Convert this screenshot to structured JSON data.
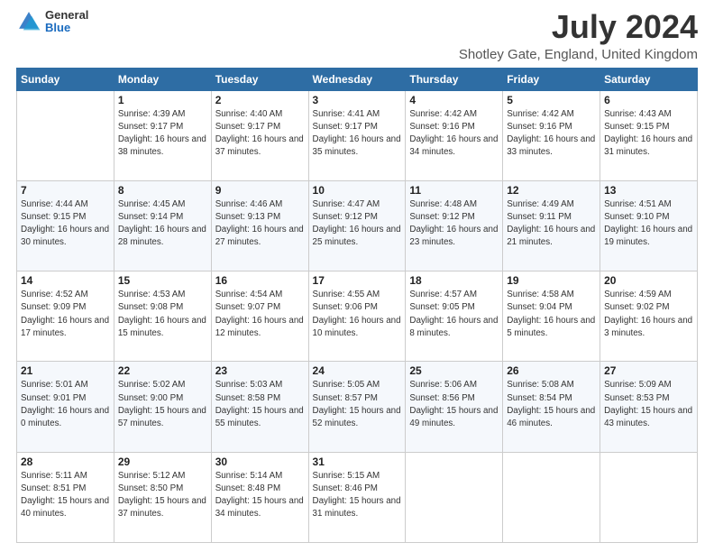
{
  "logo": {
    "line1": "General",
    "line2": "Blue"
  },
  "title": "July 2024",
  "subtitle": "Shotley Gate, England, United Kingdom",
  "days_of_week": [
    "Sunday",
    "Monday",
    "Tuesday",
    "Wednesday",
    "Thursday",
    "Friday",
    "Saturday"
  ],
  "weeks": [
    [
      {
        "day": "",
        "sunrise": "",
        "sunset": "",
        "daylight": ""
      },
      {
        "day": "1",
        "sunrise": "Sunrise: 4:39 AM",
        "sunset": "Sunset: 9:17 PM",
        "daylight": "Daylight: 16 hours and 38 minutes."
      },
      {
        "day": "2",
        "sunrise": "Sunrise: 4:40 AM",
        "sunset": "Sunset: 9:17 PM",
        "daylight": "Daylight: 16 hours and 37 minutes."
      },
      {
        "day": "3",
        "sunrise": "Sunrise: 4:41 AM",
        "sunset": "Sunset: 9:17 PM",
        "daylight": "Daylight: 16 hours and 35 minutes."
      },
      {
        "day": "4",
        "sunrise": "Sunrise: 4:42 AM",
        "sunset": "Sunset: 9:16 PM",
        "daylight": "Daylight: 16 hours and 34 minutes."
      },
      {
        "day": "5",
        "sunrise": "Sunrise: 4:42 AM",
        "sunset": "Sunset: 9:16 PM",
        "daylight": "Daylight: 16 hours and 33 minutes."
      },
      {
        "day": "6",
        "sunrise": "Sunrise: 4:43 AM",
        "sunset": "Sunset: 9:15 PM",
        "daylight": "Daylight: 16 hours and 31 minutes."
      }
    ],
    [
      {
        "day": "7",
        "sunrise": "Sunrise: 4:44 AM",
        "sunset": "Sunset: 9:15 PM",
        "daylight": "Daylight: 16 hours and 30 minutes."
      },
      {
        "day": "8",
        "sunrise": "Sunrise: 4:45 AM",
        "sunset": "Sunset: 9:14 PM",
        "daylight": "Daylight: 16 hours and 28 minutes."
      },
      {
        "day": "9",
        "sunrise": "Sunrise: 4:46 AM",
        "sunset": "Sunset: 9:13 PM",
        "daylight": "Daylight: 16 hours and 27 minutes."
      },
      {
        "day": "10",
        "sunrise": "Sunrise: 4:47 AM",
        "sunset": "Sunset: 9:12 PM",
        "daylight": "Daylight: 16 hours and 25 minutes."
      },
      {
        "day": "11",
        "sunrise": "Sunrise: 4:48 AM",
        "sunset": "Sunset: 9:12 PM",
        "daylight": "Daylight: 16 hours and 23 minutes."
      },
      {
        "day": "12",
        "sunrise": "Sunrise: 4:49 AM",
        "sunset": "Sunset: 9:11 PM",
        "daylight": "Daylight: 16 hours and 21 minutes."
      },
      {
        "day": "13",
        "sunrise": "Sunrise: 4:51 AM",
        "sunset": "Sunset: 9:10 PM",
        "daylight": "Daylight: 16 hours and 19 minutes."
      }
    ],
    [
      {
        "day": "14",
        "sunrise": "Sunrise: 4:52 AM",
        "sunset": "Sunset: 9:09 PM",
        "daylight": "Daylight: 16 hours and 17 minutes."
      },
      {
        "day": "15",
        "sunrise": "Sunrise: 4:53 AM",
        "sunset": "Sunset: 9:08 PM",
        "daylight": "Daylight: 16 hours and 15 minutes."
      },
      {
        "day": "16",
        "sunrise": "Sunrise: 4:54 AM",
        "sunset": "Sunset: 9:07 PM",
        "daylight": "Daylight: 16 hours and 12 minutes."
      },
      {
        "day": "17",
        "sunrise": "Sunrise: 4:55 AM",
        "sunset": "Sunset: 9:06 PM",
        "daylight": "Daylight: 16 hours and 10 minutes."
      },
      {
        "day": "18",
        "sunrise": "Sunrise: 4:57 AM",
        "sunset": "Sunset: 9:05 PM",
        "daylight": "Daylight: 16 hours and 8 minutes."
      },
      {
        "day": "19",
        "sunrise": "Sunrise: 4:58 AM",
        "sunset": "Sunset: 9:04 PM",
        "daylight": "Daylight: 16 hours and 5 minutes."
      },
      {
        "day": "20",
        "sunrise": "Sunrise: 4:59 AM",
        "sunset": "Sunset: 9:02 PM",
        "daylight": "Daylight: 16 hours and 3 minutes."
      }
    ],
    [
      {
        "day": "21",
        "sunrise": "Sunrise: 5:01 AM",
        "sunset": "Sunset: 9:01 PM",
        "daylight": "Daylight: 16 hours and 0 minutes."
      },
      {
        "day": "22",
        "sunrise": "Sunrise: 5:02 AM",
        "sunset": "Sunset: 9:00 PM",
        "daylight": "Daylight: 15 hours and 57 minutes."
      },
      {
        "day": "23",
        "sunrise": "Sunrise: 5:03 AM",
        "sunset": "Sunset: 8:58 PM",
        "daylight": "Daylight: 15 hours and 55 minutes."
      },
      {
        "day": "24",
        "sunrise": "Sunrise: 5:05 AM",
        "sunset": "Sunset: 8:57 PM",
        "daylight": "Daylight: 15 hours and 52 minutes."
      },
      {
        "day": "25",
        "sunrise": "Sunrise: 5:06 AM",
        "sunset": "Sunset: 8:56 PM",
        "daylight": "Daylight: 15 hours and 49 minutes."
      },
      {
        "day": "26",
        "sunrise": "Sunrise: 5:08 AM",
        "sunset": "Sunset: 8:54 PM",
        "daylight": "Daylight: 15 hours and 46 minutes."
      },
      {
        "day": "27",
        "sunrise": "Sunrise: 5:09 AM",
        "sunset": "Sunset: 8:53 PM",
        "daylight": "Daylight: 15 hours and 43 minutes."
      }
    ],
    [
      {
        "day": "28",
        "sunrise": "Sunrise: 5:11 AM",
        "sunset": "Sunset: 8:51 PM",
        "daylight": "Daylight: 15 hours and 40 minutes."
      },
      {
        "day": "29",
        "sunrise": "Sunrise: 5:12 AM",
        "sunset": "Sunset: 8:50 PM",
        "daylight": "Daylight: 15 hours and 37 minutes."
      },
      {
        "day": "30",
        "sunrise": "Sunrise: 5:14 AM",
        "sunset": "Sunset: 8:48 PM",
        "daylight": "Daylight: 15 hours and 34 minutes."
      },
      {
        "day": "31",
        "sunrise": "Sunrise: 5:15 AM",
        "sunset": "Sunset: 8:46 PM",
        "daylight": "Daylight: 15 hours and 31 minutes."
      },
      {
        "day": "",
        "sunrise": "",
        "sunset": "",
        "daylight": ""
      },
      {
        "day": "",
        "sunrise": "",
        "sunset": "",
        "daylight": ""
      },
      {
        "day": "",
        "sunrise": "",
        "sunset": "",
        "daylight": ""
      }
    ]
  ]
}
